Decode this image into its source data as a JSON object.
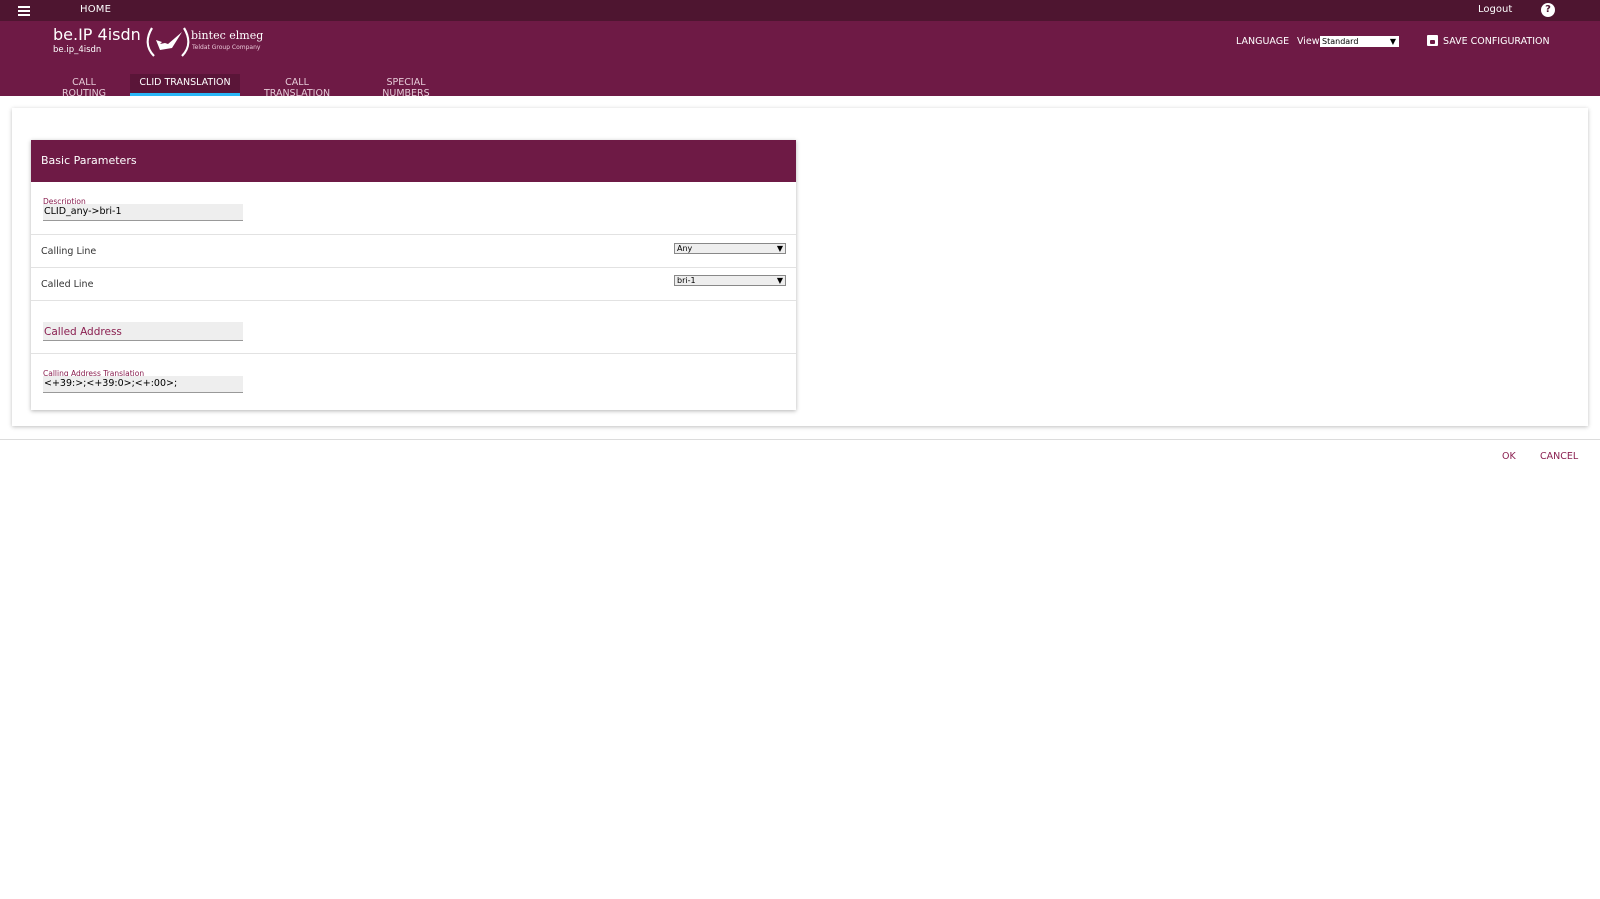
{
  "topbar": {
    "home_label": "HOME",
    "logout_label": "Logout",
    "help_icon": "?"
  },
  "header": {
    "product_title": "be.IP 4isdn",
    "product_subtitle": "be.ip_4isdn",
    "brand_name": "bintec elmeg",
    "brand_tag": "Teldat Group Company",
    "language_label": "LANGUAGE",
    "view_label": "View",
    "view_value": "Standard",
    "save_label": "SAVE CONFIGURATION"
  },
  "tabs": [
    {
      "label": "CALL ROUTING",
      "active": false
    },
    {
      "label": "CLID TRANSLATION",
      "active": true
    },
    {
      "label": "CALL TRANSLATION",
      "active": false
    },
    {
      "label": "SPECIAL NUMBERS",
      "active": false
    }
  ],
  "panel": {
    "title": "Basic Parameters",
    "description_label": "Description",
    "description_value": "CLID_any->bri-1",
    "calling_line_label": "Calling Line",
    "calling_line_value": "Any",
    "called_line_label": "Called Line",
    "called_line_value": "bri-1",
    "called_address_placeholder": "Called Address",
    "calling_translation_label": "Calling Address Translation",
    "calling_translation_value": "<+39:>;<+39:0>;<+:00>;"
  },
  "actions": {
    "ok_label": "OK",
    "cancel_label": "CANCEL"
  },
  "colors": {
    "topbar": "#4e1530",
    "header": "#6e1a45",
    "active_tab_indicator": "#29b6f6",
    "accent_text": "#8a1f50"
  }
}
